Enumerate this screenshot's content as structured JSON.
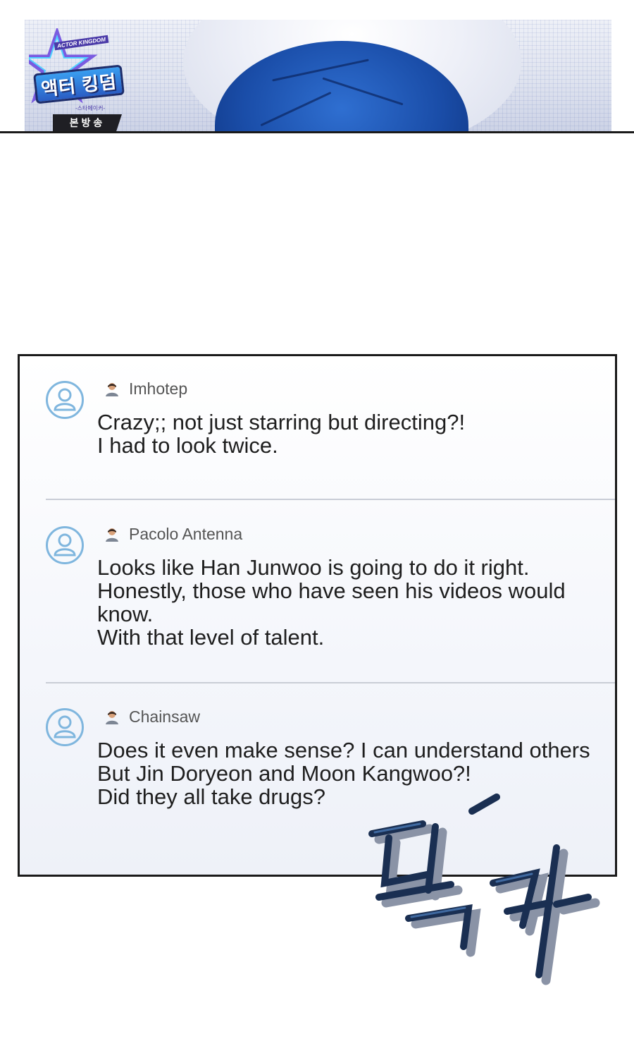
{
  "banner": {
    "logo_subtitle": "ACTOR KINGDOM",
    "logo_title": "액터 킹덤",
    "logo_tag": "-스타메이커-",
    "badge_label": "본방송"
  },
  "comments": [
    {
      "username": "Imhotep",
      "text": "Crazy;; not just starring but directing?!\nI had to look twice."
    },
    {
      "username": "Pacolo Antenna",
      "text": "Looks like Han Junwoo is going to do it right.\nHonestly, those who have seen his videos would know.\nWith that level of talent."
    },
    {
      "username": "Chainsaw",
      "text": "Does it even make sense? I can understand others\nBut Jin Doryeon and Moon Kangwoo?!\nDid they all take drugs?"
    }
  ],
  "sfx": {
    "text": "탈칵"
  },
  "colors": {
    "avatar_ring": "#7fb6de",
    "panel_border": "#1a1a1a",
    "sfx_dark": "#1a2f52",
    "sfx_shadow": "#8a93a6"
  }
}
